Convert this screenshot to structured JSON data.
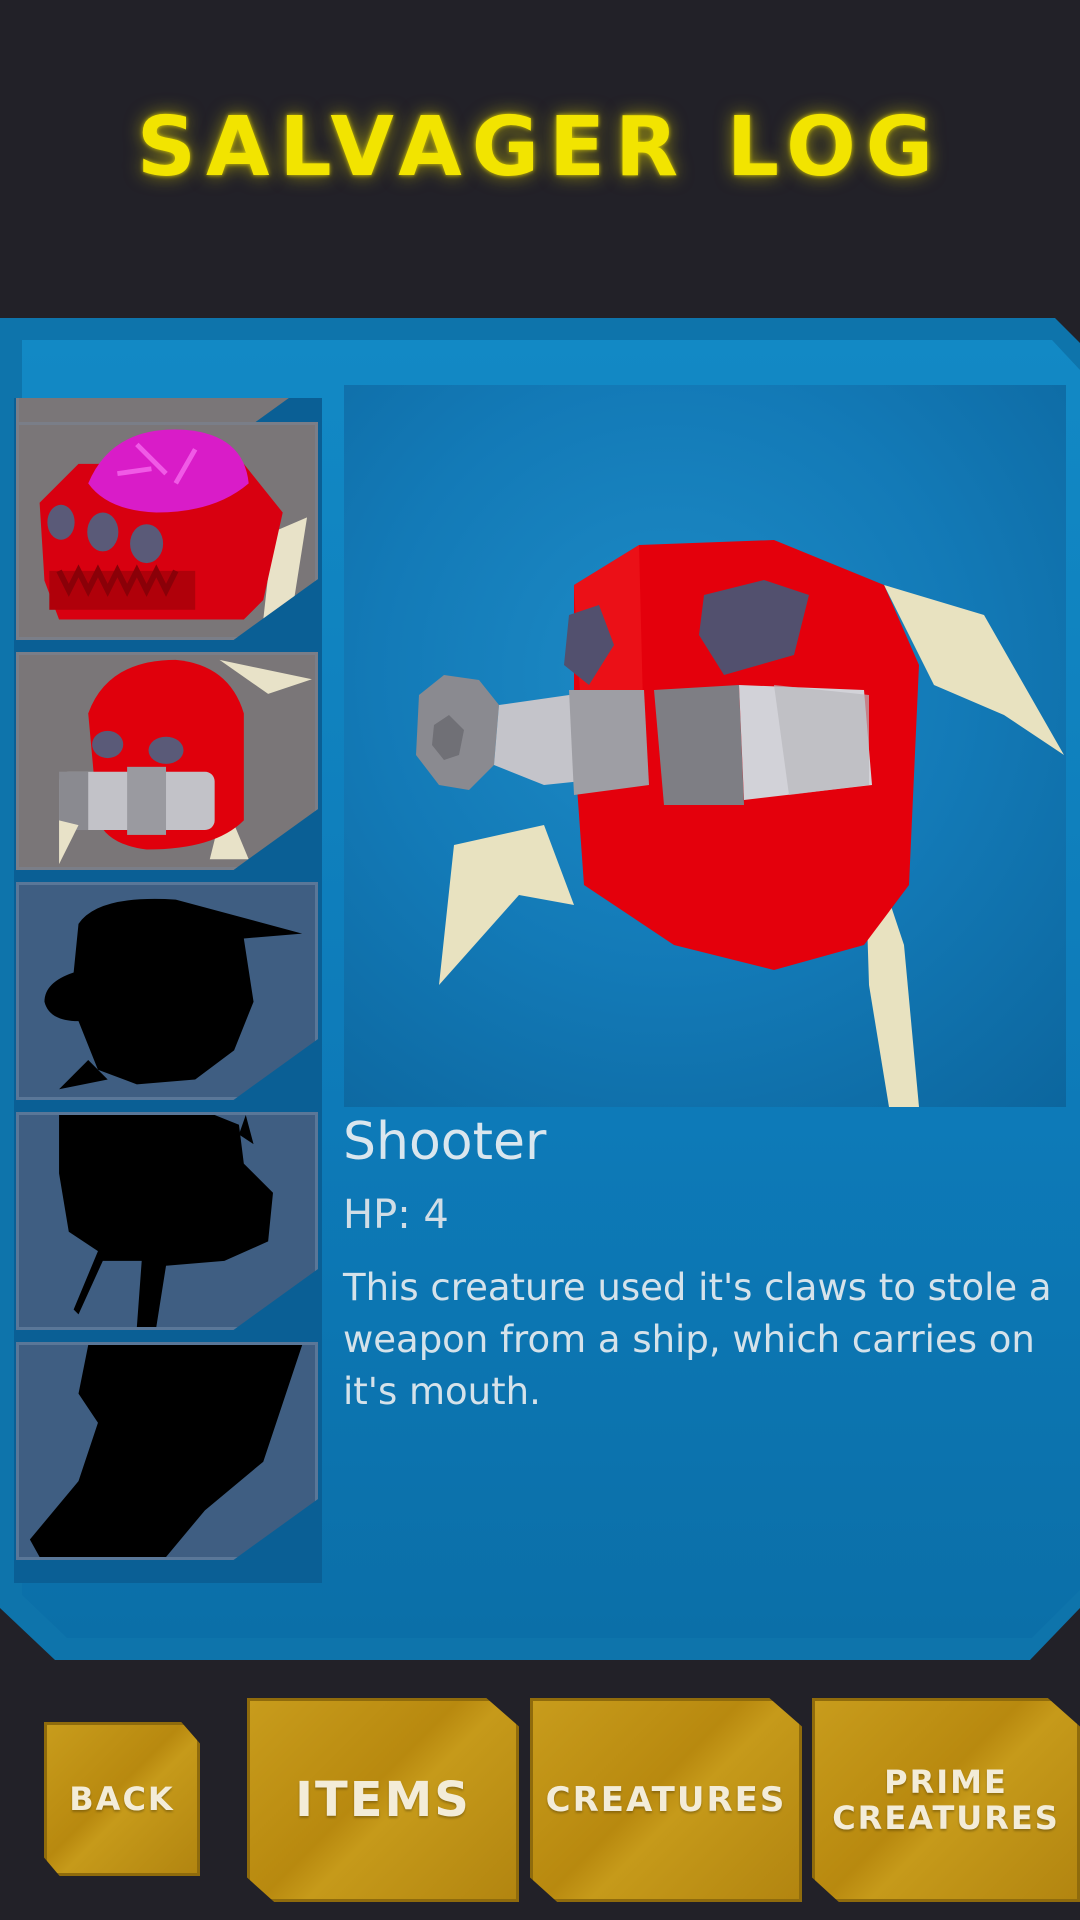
{
  "header": {
    "title": "SALVAGER LOG"
  },
  "creature_list": {
    "slots": [
      {
        "name": "partial-top-slot",
        "state": "unlocked"
      },
      {
        "name": "brain-crab-creature",
        "state": "unlocked"
      },
      {
        "name": "shooter-creature",
        "state": "unlocked",
        "selected": true
      },
      {
        "name": "locked-creature-1",
        "state": "locked"
      },
      {
        "name": "locked-creature-2",
        "state": "locked"
      },
      {
        "name": "locked-creature-3",
        "state": "locked"
      }
    ]
  },
  "detail": {
    "name": "Shooter",
    "hp": "HP: 4",
    "description": "This creature used it's claws to stole a weapon from a ship, which carries on it's mouth."
  },
  "buttons": {
    "back": "BACK",
    "items": "ITEMS",
    "creatures": "CREATURES",
    "prime_line1": "PRIME",
    "prime_line2": "CREATURES"
  },
  "colors": {
    "title": "#f2e400",
    "panel": "#0e74ab",
    "button": "#c89c1c",
    "creature_red": "#e3000c"
  }
}
